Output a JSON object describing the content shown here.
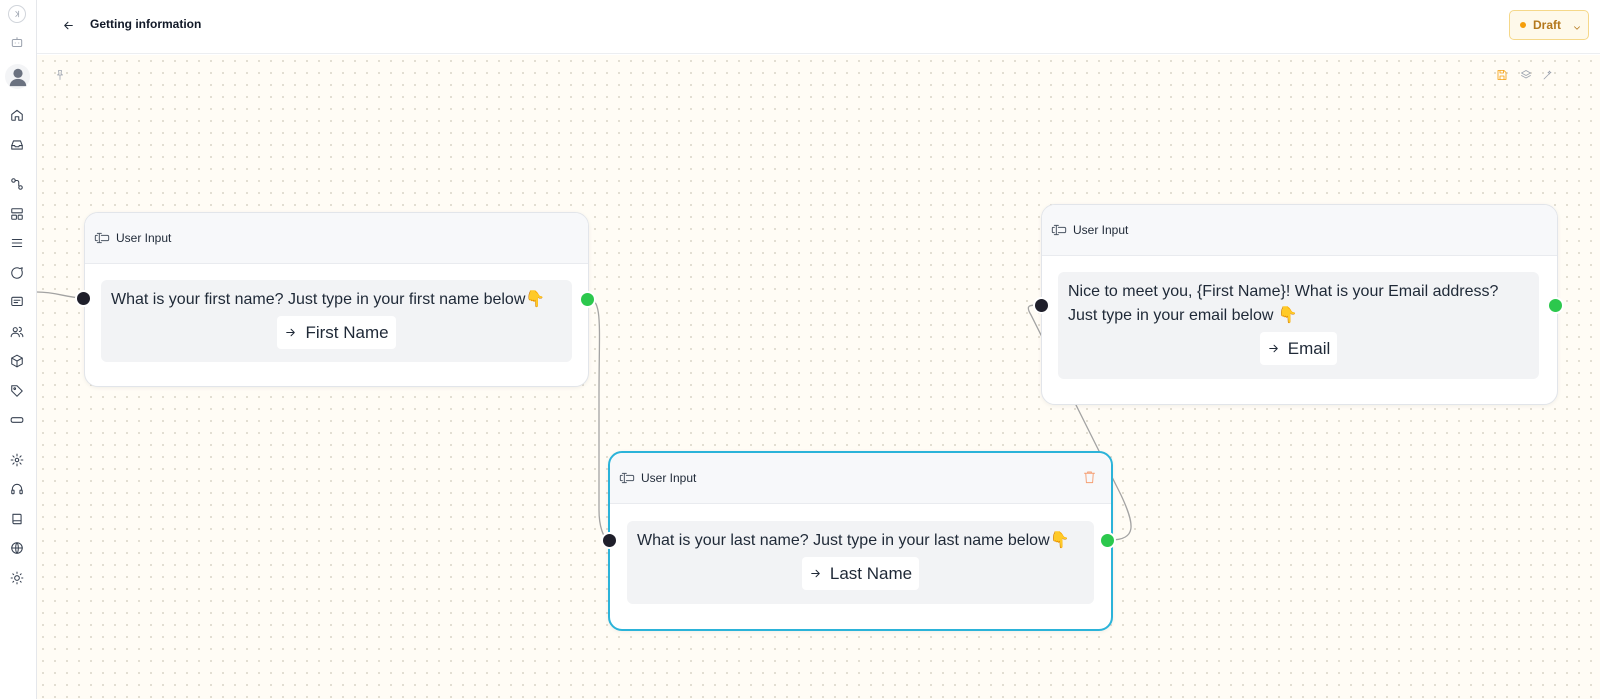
{
  "header": {
    "title": "Getting information",
    "status": {
      "label": "Draft",
      "color": "#f59e0b"
    }
  },
  "sidebar": {
    "icons": [
      "collapse-icon",
      "bot-icon",
      "avatar",
      "home-icon",
      "inbox-icon",
      "workflow-icon",
      "templates-icon",
      "list-icon",
      "chat-icon",
      "message-icon",
      "contacts-icon",
      "package-icon",
      "tag-icon",
      "input-icon",
      "settings-icon",
      "support-icon",
      "book-icon",
      "globe-icon",
      "theme-icon"
    ]
  },
  "canvas": {
    "tools": [
      "pin-icon",
      "save-icon",
      "layers-icon",
      "magic-wand-icon"
    ],
    "nodes": [
      {
        "header": "User Input",
        "question": "What is your first name? Just type in your first name below👇",
        "variable": "First Name"
      },
      {
        "header": "User Input",
        "question": "What is your last name? Just type in your last name below👇",
        "variable": "Last Name"
      },
      {
        "header": "User Input",
        "question": "Nice to meet you, {First Name}! What is your Email address? Just type in your email below 👇",
        "variable": "Email"
      }
    ]
  },
  "colors": {
    "accent_selected": "#2bb3d9",
    "handle_in": "#1f1f2b",
    "handle_out": "#2cc84d",
    "draft_bg": "#fef9ea"
  }
}
